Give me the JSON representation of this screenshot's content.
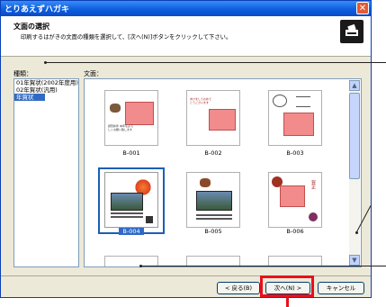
{
  "window": {
    "title": "とりあえずハガキ",
    "close_glyph": "✕"
  },
  "header": {
    "title": "文面の選択",
    "description": "印刷するはがきの文面の種類を選択して、[次へ(N)]ボタンをクリックして下さい。",
    "icon": "printer-icon"
  },
  "type_list": {
    "label": "種類：",
    "items": [
      "01年賀状(2002年度用)",
      "02年賀状(汎用)",
      "年賀状"
    ],
    "selected_index": 2
  },
  "preview": {
    "label": "文面：",
    "cards": [
      {
        "label": "B-001",
        "greeting": "謹賀新年 本年もよろしくお願い致します"
      },
      {
        "label": "B-002",
        "greeting": "あけましておめでとうございます"
      },
      {
        "label": "B-003",
        "greeting": ""
      },
      {
        "label": "B-004",
        "greeting": ""
      },
      {
        "label": "B-005",
        "greeting": ""
      },
      {
        "label": "B-006",
        "greeting": "賀正"
      }
    ],
    "selected_index": 3
  },
  "scrollbar": {
    "up_glyph": "▲",
    "down_glyph": "▼"
  },
  "buttons": {
    "back": "< 戻る(B)",
    "next": "次へ(N) >",
    "cancel": "キャンセル"
  },
  "colors": {
    "title_bar": "#0d5ee0",
    "selection": "#316ac5",
    "highlight": "#e8101a",
    "pink_panel": "#f28b8b"
  }
}
